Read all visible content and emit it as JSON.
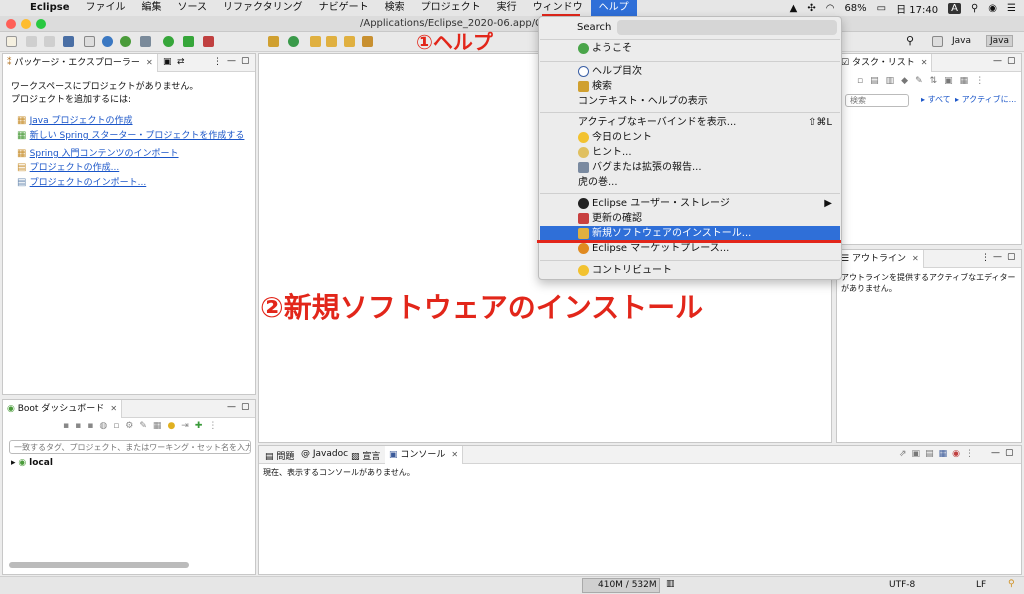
{
  "menubar": {
    "apple": "",
    "items": [
      "Eclipse",
      "ファイル",
      "編集",
      "ソース",
      "リファクタリング",
      "ナビゲート",
      "検索",
      "プロジェクト",
      "実行",
      "ウィンドウ",
      "ヘルプ"
    ],
    "battery": "68%",
    "clock": "日 17:40",
    "input_mode": "A"
  },
  "window": {
    "title": "/Applications/Eclipse_2020-06.app/Con"
  },
  "toolbar": {
    "perspective_java_1": "Java",
    "perspective_java_2": "Java"
  },
  "package_explorer": {
    "tab": "パッケージ・エクスプローラー",
    "message1": "ワークスペースにプロジェクトがありません。",
    "message2": "プロジェクトを追加するには:",
    "links": [
      "Java プロジェクトの作成",
      "新しい Spring スターター・プロジェクトを作成する",
      "Spring 入門コンテンツのインポート",
      "プロジェクトの作成...",
      "プロジェクトのインポート..."
    ]
  },
  "boot_dashboard": {
    "tab": "Boot ダッシュボード",
    "filter_placeholder": "一致するタグ、プロジェクト、またはワーキング・セット名を入力し",
    "node": "local"
  },
  "task_list": {
    "tab": "タスク・リスト",
    "search_placeholder": "検索",
    "all": "すべて",
    "active": "アクティブに..."
  },
  "outline": {
    "tab": "アウトライン",
    "message": "アウトラインを提供するアクティブなエディターがありません。"
  },
  "bottom_tabs": {
    "problems": "問題",
    "javadoc": "Javadoc",
    "declaration": "宣言",
    "console": "コンソール",
    "console_message": "現在、表示するコンソールがありません。"
  },
  "help_menu": {
    "search_label": "Search",
    "items": {
      "welcome": "ようこそ",
      "help_contents": "ヘルプ目次",
      "search": "検索",
      "context_help": "コンテキスト・ヘルプの表示",
      "key_assist": "アクティブなキーバインドを表示...",
      "key_assist_shortcut": "⇧⌘L",
      "tip_of_day": "今日のヒント",
      "tips": "ヒント...",
      "report_bug": "バグまたは拡張の報告...",
      "cheatsheets": "虎の巻...",
      "user_storage": "Eclipse ユーザー・ストレージ",
      "check_updates": "更新の確認",
      "install_software": "新規ソフトウェアのインストール...",
      "marketplace": "Eclipse マーケットプレース...",
      "contribute": "コントリビュート"
    }
  },
  "annotations": {
    "step1": "①ヘルプ",
    "step2": "②新規ソフトウェアのインストール"
  },
  "status": {
    "memory": "410M / 532M",
    "encoding": "UTF-8",
    "line_ending": "LF"
  },
  "colors": {
    "accent": "#2f6fd8",
    "annotation_red": "#e2261a",
    "link": "#1a55c8"
  }
}
